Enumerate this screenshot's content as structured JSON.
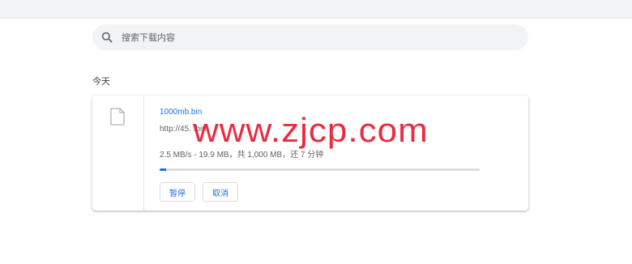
{
  "search": {
    "placeholder": "搜索下载内容",
    "value": ""
  },
  "section": {
    "date_label": "今天"
  },
  "download": {
    "file_name": "1000mb.bin",
    "url": "http://45.                                .bin",
    "status": "2.5 MB/s - 19.9 MB，共 1,000 MB，还    7 分钟",
    "progress_fraction": 0.02,
    "pause_label": "暂停",
    "cancel_label": "取消"
  },
  "watermark": {
    "text": "www.zjcp.com"
  },
  "colors": {
    "accent": "#1a73e8",
    "watermark": "#e80e26"
  }
}
